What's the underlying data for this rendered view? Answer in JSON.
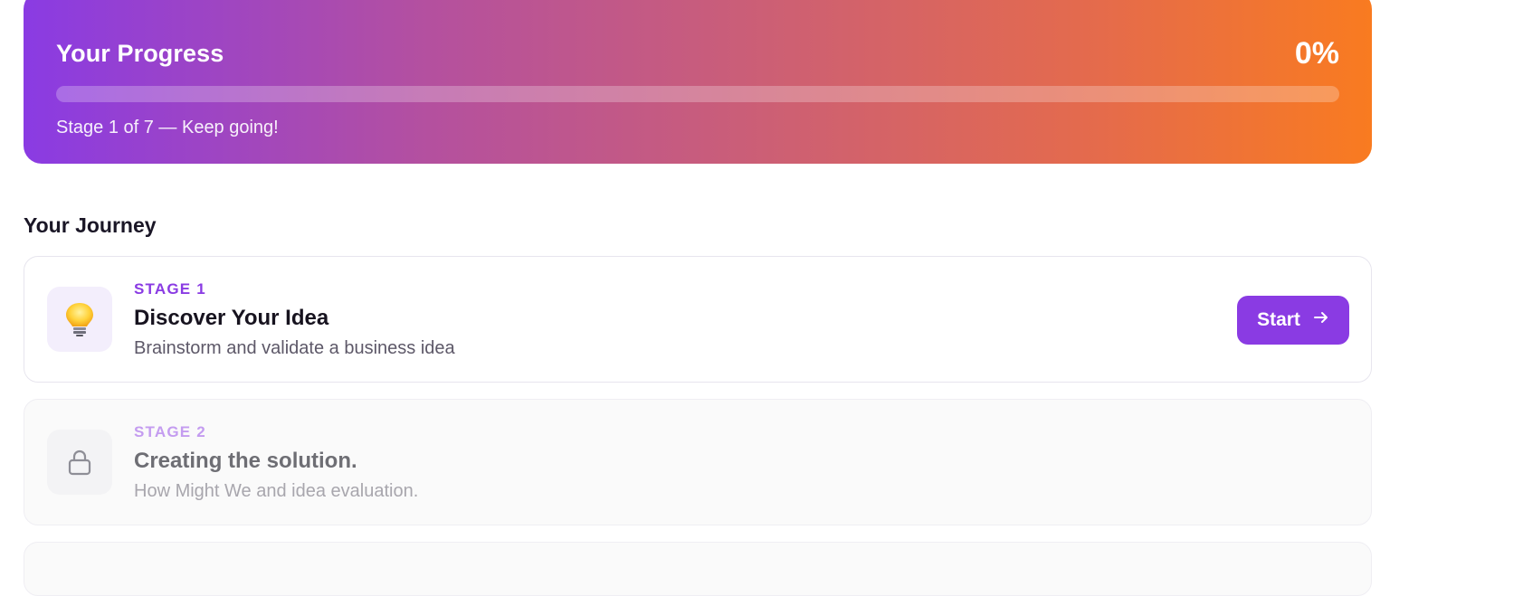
{
  "progress": {
    "title": "Your Progress",
    "percent_label": "0%",
    "percent_value": 0,
    "status": "Stage 1 of 7 — Keep going!"
  },
  "journey": {
    "title": "Your Journey",
    "stages": [
      {
        "kicker": "STAGE 1",
        "name": "Discover Your Idea",
        "description": "Brainstorm and validate a business idea",
        "icon": "lightbulb-icon",
        "state": "active",
        "button_label": "Start"
      },
      {
        "kicker": "STAGE 2",
        "name": "Creating the solution.",
        "description": "How Might We and idea evaluation.",
        "icon": "lock-icon",
        "state": "locked"
      }
    ]
  },
  "colors": {
    "accent": "#8a3be3",
    "gradient_start": "#8a3be3",
    "gradient_end": "#f97b20"
  }
}
